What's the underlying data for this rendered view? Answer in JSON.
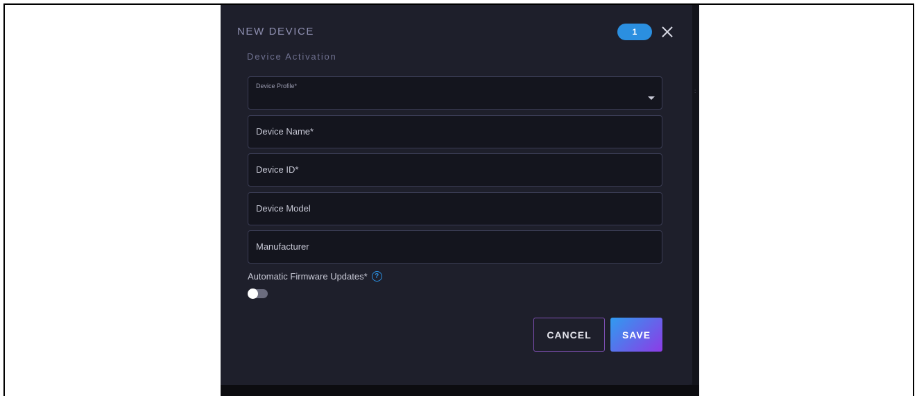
{
  "modal": {
    "title": "NEW DEVICE",
    "step_badge": "1",
    "subtitle": "Device Activation",
    "close_icon": "close-icon"
  },
  "form": {
    "device_profile": {
      "label": "Device Profile*",
      "value": ""
    },
    "device_name": {
      "placeholder": "Device Name*",
      "value": ""
    },
    "device_id": {
      "placeholder": "Device ID*",
      "value": ""
    },
    "device_model": {
      "placeholder": "Device Model",
      "value": ""
    },
    "manufacturer": {
      "placeholder": "Manufacturer",
      "value": ""
    },
    "firmware": {
      "label": "Automatic Firmware Updates*",
      "help_icon": "question-circle-icon",
      "enabled": false
    }
  },
  "actions": {
    "cancel_label": "CANCEL",
    "save_label": "SAVE"
  },
  "colors": {
    "accent_blue": "#2b8fe0",
    "accent_purple": "#8d3be6",
    "modal_bg": "#1e1f2b",
    "field_bg": "#14151e"
  }
}
